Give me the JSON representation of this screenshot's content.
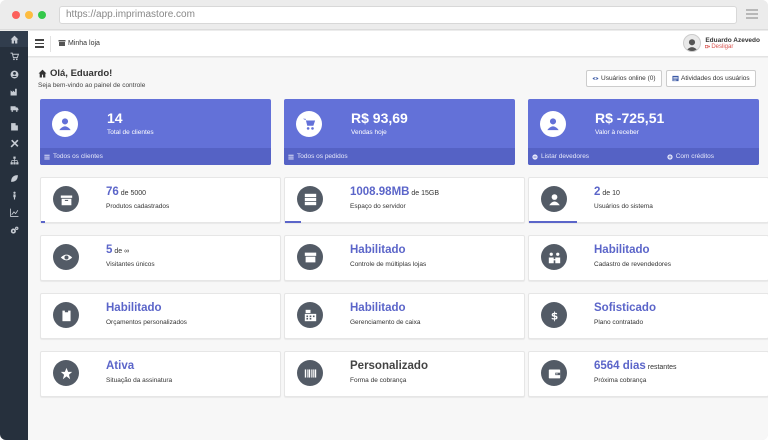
{
  "browser": {
    "url": "https://app.imprimastore.com"
  },
  "sidebar": {
    "items": [
      {
        "icon": "home-icon",
        "active": true
      },
      {
        "icon": "cart-icon"
      },
      {
        "icon": "user-icon"
      },
      {
        "icon": "factory-icon"
      },
      {
        "icon": "truck-icon"
      },
      {
        "icon": "building-icon"
      },
      {
        "icon": "tools-icon"
      },
      {
        "icon": "sitemap-icon"
      },
      {
        "icon": "leaf-icon"
      },
      {
        "icon": "person-icon"
      },
      {
        "icon": "chart-icon"
      },
      {
        "icon": "cogs-icon"
      }
    ]
  },
  "topbar": {
    "store_label": "Minha loja",
    "user_name": "Eduardo Azevedo",
    "logout_label": "Desligar"
  },
  "header": {
    "greeting": "Olá, Eduardo!",
    "welcome": "Seja bem-vindo ao painel de controle",
    "online_button": "Usuários online (0)",
    "activity_button": "Atividades dos usuários"
  },
  "summary": [
    {
      "value": "14",
      "label": "Total de clientes",
      "footer_left": "Todos os clientes",
      "footer_right": ""
    },
    {
      "value": "R$ 93,69",
      "label": "Vendas hoje",
      "footer_left": "Todos os pedidos",
      "footer_right": ""
    },
    {
      "value": "R$ -725,51",
      "label": "Valor à receber",
      "footer_left": "Listar devedores",
      "footer_right": "Com créditos"
    }
  ],
  "stats": [
    {
      "value": "76",
      "suffix": " de 5000",
      "label": "Produtos cadastrados",
      "progress": 0.015
    },
    {
      "value": "1008.98MB",
      "suffix": " de 15GB",
      "label": "Espaço do servidor",
      "progress": 0.066
    },
    {
      "value": "2",
      "suffix": " de 10",
      "label": "Usuários do sistema",
      "progress": 0.2
    },
    {
      "value": "5",
      "suffix": " de ∞",
      "label": "Visitantes únicos"
    },
    {
      "value": "Habilitado",
      "suffix": "",
      "label": "Controle de múltiplas lojas"
    },
    {
      "value": "Habilitado",
      "suffix": "",
      "label": "Cadastro de revendedores"
    },
    {
      "value": "Habilitado",
      "suffix": "",
      "label": "Orçamentos personalizados"
    },
    {
      "value": "Habilitado",
      "suffix": "",
      "label": "Gerenciamento de caixa"
    },
    {
      "value": "Sofisticado",
      "suffix": "",
      "label": "Plano contratado"
    },
    {
      "value": "Ativa",
      "suffix": "",
      "label": "Situação da assinatura"
    },
    {
      "value": "Personalizado",
      "suffix": "",
      "label": "Forma de cobrança"
    },
    {
      "value": "6564 dias",
      "suffix": " restantes",
      "label": "Próxima cobrança"
    }
  ],
  "colors": {
    "accent": "#6371d8",
    "sidebar": "#26303d",
    "icon_bg": "#535b66"
  }
}
